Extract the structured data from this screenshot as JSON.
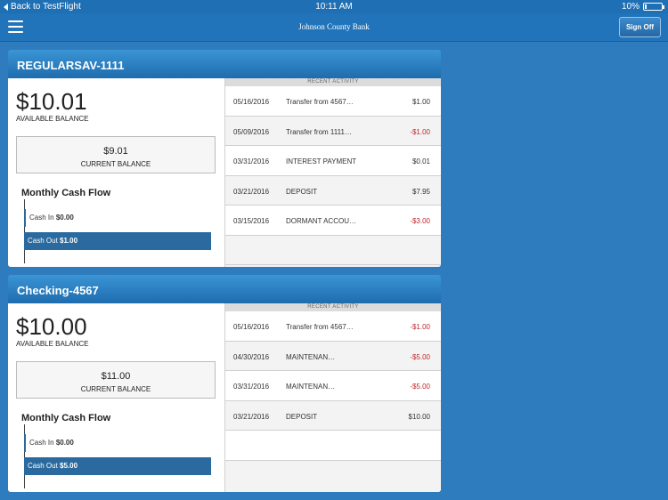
{
  "status_bar": {
    "back_label": "Back to TestFlight",
    "time": "10:11 AM",
    "battery": "10%",
    "battery_level": 0.1
  },
  "nav": {
    "title": "Johnson County Bank",
    "sign_off_label": "Sign Off"
  },
  "accounts": [
    {
      "name": "REGULARSAV-1111",
      "available_balance": "$10.01",
      "available_label": "AVAILABLE BALANCE",
      "current_balance": "$9.01",
      "current_label": "CURRENT BALANCE",
      "cash_flow_title": "Monthly Cash Flow",
      "cash_in_label": "Cash In",
      "cash_in": "$0.00",
      "cash_out_label": "Cash Out",
      "cash_out": "$1.00",
      "recent_activity_label": "RECENT ACTIVITY",
      "transactions": [
        {
          "date": "05/16/2016",
          "description": "Transfer from 4567…",
          "amount": "$1.00",
          "negative": false
        },
        {
          "date": "05/09/2016",
          "description": "Transfer from 1111…",
          "amount": "-$1.00",
          "negative": true
        },
        {
          "date": "03/31/2016",
          "description": "INTEREST PAYMENT",
          "amount": "$0.01",
          "negative": false
        },
        {
          "date": "03/21/2016",
          "description": "DEPOSIT",
          "amount": "$7.95",
          "negative": false
        },
        {
          "date": "03/15/2016",
          "description": "DORMANT ACCOU…",
          "amount": "-$3.00",
          "negative": true
        }
      ]
    },
    {
      "name": "Checking-4567",
      "available_balance": "$10.00",
      "available_label": "AVAILABLE BALANCE",
      "current_balance": "$11.00",
      "current_label": "CURRENT BALANCE",
      "cash_flow_title": "Monthly Cash Flow",
      "cash_in_label": "Cash In",
      "cash_in": "$0.00",
      "cash_out_label": "Cash Out",
      "cash_out": "$5.00",
      "recent_activity_label": "RECENT ACTIVITY",
      "transactions": [
        {
          "date": "05/16/2016",
          "description": "Transfer from 4567…",
          "amount": "-$1.00",
          "negative": true
        },
        {
          "date": "04/30/2016",
          "description": "MAINTENAN…",
          "amount": "-$5.00",
          "negative": true
        },
        {
          "date": "03/31/2016",
          "description": "MAINTENAN…",
          "amount": "-$5.00",
          "negative": true
        },
        {
          "date": "03/21/2016",
          "description": "DEPOSIT",
          "amount": "$10.00",
          "negative": false
        }
      ]
    }
  ],
  "colors": {
    "background": "#2e7cbd",
    "header": "#1e6cae",
    "cash_out_bar": "#2a6a9f",
    "negative": "#c0282d"
  }
}
